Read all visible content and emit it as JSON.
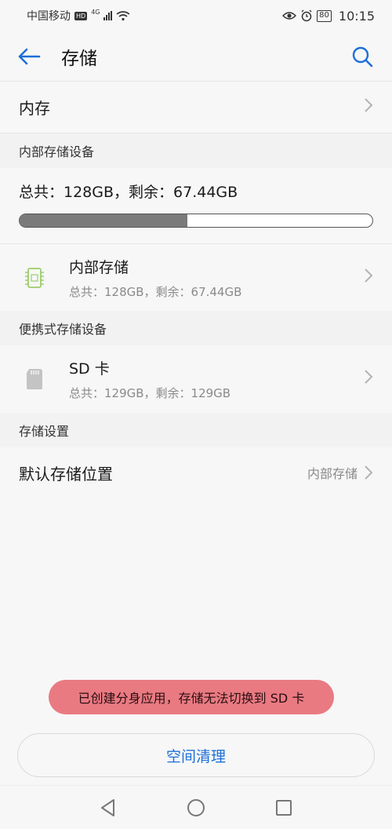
{
  "status_bar": {
    "carrier": "中国移动",
    "hd_badge": "HD",
    "net_type": "4G",
    "battery": "80",
    "time": "10:15"
  },
  "app_bar": {
    "title": "存储",
    "accent_color": "#1e6fd9"
  },
  "memory_row": {
    "label": "内存"
  },
  "internal_section": {
    "header": "内部存储设备",
    "summary": "总共：128GB，剩余：67.44GB",
    "used_fraction": 0.475,
    "device": {
      "name": "内部存储",
      "detail": "总共：128GB，剩余：67.44GB",
      "icon": "chip-icon",
      "icon_color": "#9acd6a"
    }
  },
  "portable_section": {
    "header": "便携式存储设备",
    "device": {
      "name": "SD 卡",
      "detail": "总共：129GB，剩余：129GB",
      "icon": "sd-card-icon"
    }
  },
  "settings_section": {
    "header": "存储设置",
    "default_location": {
      "label": "默认存储位置",
      "value": "内部存储"
    }
  },
  "toast": {
    "message": "已创建分身应用，存储无法切换到 SD 卡",
    "color": "#e97a82"
  },
  "clean_button": {
    "label": "空间清理"
  }
}
